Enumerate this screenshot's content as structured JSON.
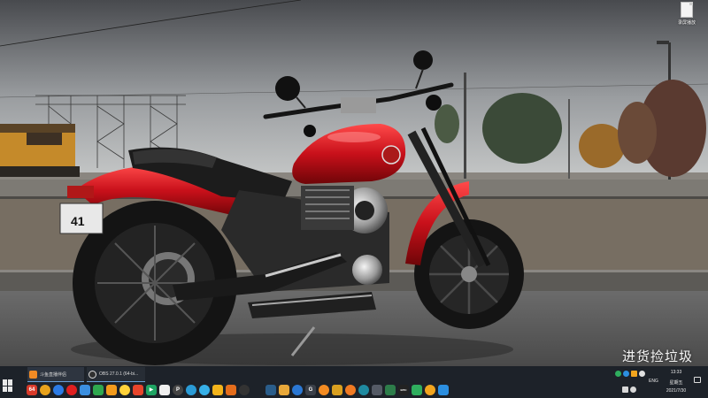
{
  "desktop": {
    "icon_label": "录屏播放",
    "watermark": "进货捡垃圾"
  },
  "taskbar": {
    "windows": [
      {
        "label": "斗鱼直播伴侣",
        "icon": "streaming-app-icon"
      },
      {
        "label": "OBS 27.0.1 (64-bi...",
        "icon": "obs-icon"
      }
    ],
    "apps": [
      {
        "name": "app-64-icon",
        "text": "64",
        "color": "#d83a2a",
        "round": false
      },
      {
        "name": "chrome-icon",
        "text": "",
        "color": "#e8a21c",
        "round": true
      },
      {
        "name": "browser-blue-icon",
        "text": "",
        "color": "#2c7be5",
        "round": true
      },
      {
        "name": "netease-music-icon",
        "text": "",
        "color": "#e02020",
        "round": true
      },
      {
        "name": "window-icon",
        "text": "",
        "color": "#3b8fe0",
        "round": false
      },
      {
        "name": "green-app-icon",
        "text": "",
        "color": "#2fa84f",
        "round": false
      },
      {
        "name": "orange-app-icon",
        "text": "",
        "color": "#f29b1d",
        "round": false
      },
      {
        "name": "face-app-icon",
        "text": "",
        "color": "#ffd23a",
        "round": true
      },
      {
        "name": "red-app-icon",
        "text": "",
        "color": "#e8452c",
        "round": false
      },
      {
        "name": "play-store-icon",
        "text": "▶",
        "color": "#1fa463",
        "round": false
      },
      {
        "name": "white-app-icon",
        "text": "",
        "color": "#f0f0f0",
        "round": false
      },
      {
        "name": "p-app-icon",
        "text": "P",
        "color": "#444",
        "round": true
      },
      {
        "name": "edge-icon",
        "text": "",
        "color": "#2a9bd6",
        "round": true
      },
      {
        "name": "edge-alt-icon",
        "text": "",
        "color": "#37b0e8",
        "round": true
      },
      {
        "name": "yellow-app-icon",
        "text": "",
        "color": "#f3b41b",
        "round": false
      },
      {
        "name": "orange-square-icon",
        "text": "",
        "color": "#e46d1c",
        "round": false
      },
      {
        "name": "github-icon",
        "text": "",
        "color": "#333",
        "round": true
      },
      {
        "name": "plant-app-icon",
        "text": "",
        "color": "#1d2229",
        "round": false
      },
      {
        "name": "steam-icon",
        "text": "",
        "color": "#2a5d8a",
        "round": false
      },
      {
        "name": "stack-app-icon",
        "text": "",
        "color": "#e8a83a",
        "round": false
      },
      {
        "name": "ring-app-icon",
        "text": "",
        "color": "#2b78d4",
        "round": true
      },
      {
        "name": "g-app-icon",
        "text": "G",
        "color": "#3a3f48",
        "round": false
      },
      {
        "name": "firefox-icon",
        "text": "",
        "color": "#f28b22",
        "round": true
      },
      {
        "name": "game-app-icon",
        "text": "",
        "color": "#d9a020",
        "round": false
      },
      {
        "name": "orange-round-icon",
        "text": "",
        "color": "#f07a22",
        "round": true
      },
      {
        "name": "teal-app-icon",
        "text": "",
        "color": "#1f8aa0",
        "round": true
      },
      {
        "name": "controller-icon",
        "text": "",
        "color": "#555b66",
        "round": false
      },
      {
        "name": "green-dark-icon",
        "text": "",
        "color": "#2d7d4a",
        "round": false
      },
      {
        "name": "epic-icon",
        "text": "EPIC",
        "color": "#222",
        "round": false
      },
      {
        "name": "shield-green-icon",
        "text": "",
        "color": "#2fae5e",
        "round": false
      },
      {
        "name": "orange-ball-icon",
        "text": "",
        "color": "#f2a51e",
        "round": true
      },
      {
        "name": "blue-shield-icon",
        "text": "",
        "color": "#2c8fe0",
        "round": false
      }
    ],
    "tray": {
      "language": "ENG",
      "time": "13:33",
      "day": "星期五",
      "date": "2021/7/30"
    }
  }
}
